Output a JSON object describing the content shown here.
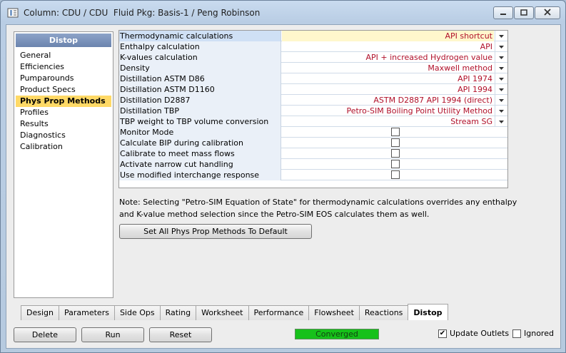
{
  "window": {
    "title": "Column: CDU / CDU  Fluid Pkg: Basis-1 / Peng Robinson"
  },
  "nav": {
    "header": "Distop",
    "items": [
      "General",
      "Efficiencies",
      "Pumparounds",
      "Product Specs",
      "Phys Prop Methods",
      "Profiles",
      "Results",
      "Diagnostics",
      "Calibration"
    ],
    "active": "Phys Prop Methods"
  },
  "grid": {
    "rows": [
      {
        "label": "Thermodynamic calculations",
        "value": "API shortcut"
      },
      {
        "label": "Enthalpy calculation",
        "value": "API"
      },
      {
        "label": "K-values calculation",
        "value": "API + increased Hydrogen value"
      },
      {
        "label": "Density",
        "value": "Maxwell method"
      },
      {
        "label": "Distillation ASTM D86",
        "value": "API 1974"
      },
      {
        "label": "Distillation ASTM D1160",
        "value": "API 1994"
      },
      {
        "label": "Distillation D2887",
        "value": "ASTM D2887 API 1994 (direct)"
      },
      {
        "label": "Distillation TBP",
        "value": "Petro-SIM Boiling Point Utility Method"
      },
      {
        "label": "TBP weight to TBP volume conversion",
        "value": "Stream SG"
      },
      {
        "label": "Monitor Mode",
        "checked": false
      },
      {
        "label": "Calculate BIP during calibration",
        "checked": false
      },
      {
        "label": "Calibrate to meet mass flows",
        "checked": false
      },
      {
        "label": "Activate narrow cut handling",
        "checked": false
      },
      {
        "label": "Use modified interchange response",
        "checked": false
      }
    ]
  },
  "note": {
    "line1": "Note: Selecting \"Petro-SIM Equation of State\" for thermodynamic calculations overrides any enthalpy",
    "line2": "and K-value method selection since the Petro-SIM EOS calculates them as well."
  },
  "buttons": {
    "default_label": "Set All Phys Prop Methods To Default",
    "delete_label": "Delete",
    "run_label": "Run",
    "reset_label": "Reset"
  },
  "tabs": [
    "Design",
    "Parameters",
    "Side Ops",
    "Rating",
    "Worksheet",
    "Performance",
    "Flowsheet",
    "Reactions",
    "Distop"
  ],
  "active_tab": "Distop",
  "status": {
    "text": "Converged",
    "color": "#16c11a"
  },
  "footer": {
    "update_outlets_label": "Update Outlets",
    "update_outlets_checked": true,
    "ignored_label": "Ignored",
    "ignored_checked": false
  },
  "colors": {
    "value_text": "#b0102a",
    "active_nav": "#ffd966",
    "nav_header": "#6b84ae"
  }
}
